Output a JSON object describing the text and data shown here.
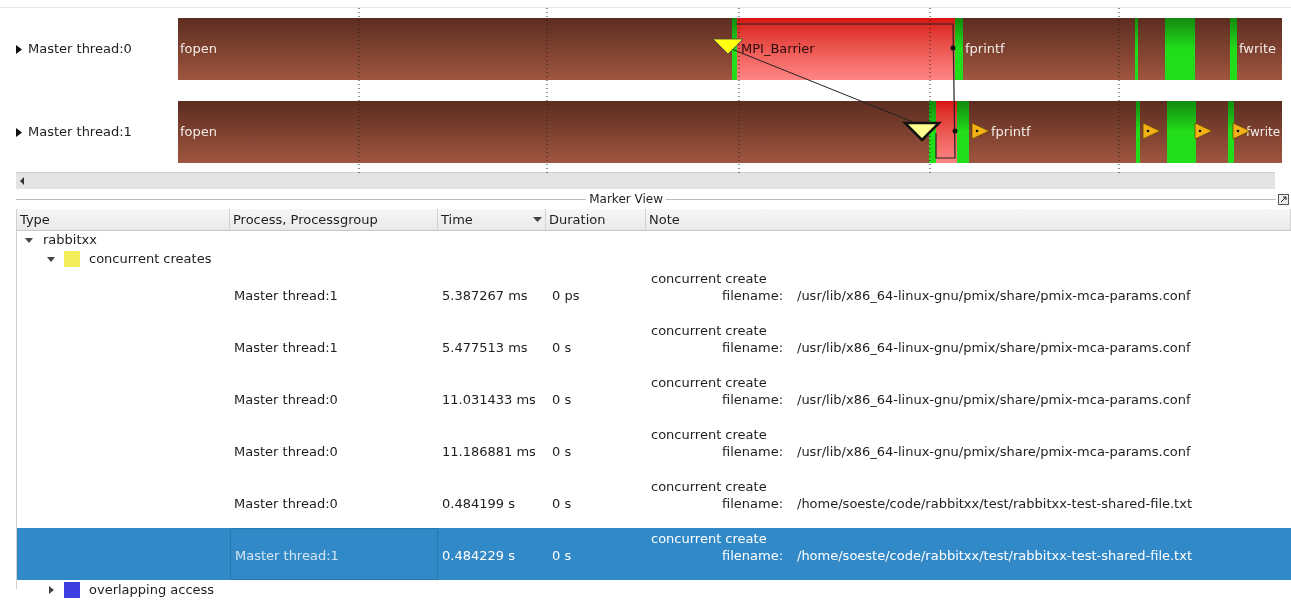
{
  "timeline": {
    "threads": [
      {
        "label": "Master thread:0",
        "expanded": false,
        "segments": [
          {
            "kind": "call",
            "label": "fopen"
          },
          {
            "kind": "other"
          },
          {
            "kind": "mpi",
            "label": "MPI_Barrier"
          },
          {
            "kind": "other"
          },
          {
            "kind": "call",
            "label": "fprintf"
          },
          {
            "kind": "other"
          },
          {
            "kind": "call"
          },
          {
            "kind": "other"
          },
          {
            "kind": "call"
          },
          {
            "kind": "other"
          },
          {
            "kind": "call",
            "label": "fwrite"
          }
        ]
      },
      {
        "label": "Master thread:1",
        "expanded": false,
        "segments": [
          {
            "kind": "call",
            "label": "fopen"
          },
          {
            "kind": "other"
          },
          {
            "kind": "mpi"
          },
          {
            "kind": "other"
          },
          {
            "kind": "call",
            "label": "fprintf"
          },
          {
            "kind": "other"
          },
          {
            "kind": "call"
          },
          {
            "kind": "other"
          },
          {
            "kind": "call"
          },
          {
            "kind": "other"
          },
          {
            "kind": "call",
            "label": "fwrite"
          }
        ]
      }
    ]
  },
  "marker_view": {
    "title": "Marker View",
    "columns": [
      {
        "label": "Type"
      },
      {
        "label": "Process, Processgroup"
      },
      {
        "label": "Time",
        "sorted": true
      },
      {
        "label": "Duration"
      },
      {
        "label": "Note"
      }
    ],
    "tree": [
      {
        "label": "rabbitxx",
        "expanded": true,
        "children": [
          {
            "label": "concurrent creates",
            "color": "#f2ee5a",
            "expanded": true,
            "rows": [
              {
                "process": "Master thread:1",
                "time": "5.387267 ms",
                "duration": "0 ps",
                "note": "concurrent create",
                "field": "filename:",
                "value": "/usr/lib/x86_64-linux-gnu/pmix/share/pmix-mca-params.conf",
                "selected": false
              },
              {
                "process": "Master thread:1",
                "time": "5.477513 ms",
                "duration": "0 s",
                "note": "concurrent create",
                "field": "filename:",
                "value": "/usr/lib/x86_64-linux-gnu/pmix/share/pmix-mca-params.conf",
                "selected": false
              },
              {
                "process": "Master thread:0",
                "time": "11.031433 ms",
                "duration": "0 s",
                "note": "concurrent create",
                "field": "filename:",
                "value": "/usr/lib/x86_64-linux-gnu/pmix/share/pmix-mca-params.conf",
                "selected": false
              },
              {
                "process": "Master thread:0",
                "time": "11.186881 ms",
                "duration": "0 s",
                "note": "concurrent create",
                "field": "filename:",
                "value": "/usr/lib/x86_64-linux-gnu/pmix/share/pmix-mca-params.conf",
                "selected": false
              },
              {
                "process": "Master thread:0",
                "time": "0.484199 s",
                "duration": "0 s",
                "note": "concurrent create",
                "field": "filename:",
                "value": "/home/soeste/code/rabbitxx/test/rabbitxx-test-shared-file.txt",
                "selected": false
              },
              {
                "process": "Master thread:1",
                "time": "0.484229 s",
                "duration": "0 s",
                "note": "concurrent create",
                "field": "filename:",
                "value": "/home/soeste/code/rabbitxx/test/rabbitxx-test-shared-file.txt",
                "selected": true
              }
            ]
          },
          {
            "label": "overlapping access",
            "color": "#3d3de0",
            "expanded": false
          }
        ]
      }
    ]
  }
}
